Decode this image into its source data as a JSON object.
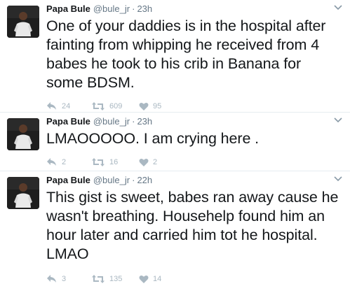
{
  "tweets": [
    {
      "fullname": "Papa Bule",
      "username": "@bule_jr",
      "separator": "·",
      "time": "23h",
      "text": "One of your daddies is in the hospital after fainting from whipping he received from 4 babes he took to his crib in Banana for some BDSM.",
      "replies": "24",
      "retweets": "609",
      "likes": "95"
    },
    {
      "fullname": "Papa Bule",
      "username": "@bule_jr",
      "separator": "·",
      "time": "23h",
      "text": "LMAOOOOO. I am crying here .",
      "replies": "2",
      "retweets": "16",
      "likes": "2"
    },
    {
      "fullname": "Papa Bule",
      "username": "@bule_jr",
      "separator": "·",
      "time": "22h",
      "text": "This gist is sweet, babes ran away cause he wasn't breathing. Househelp found him an hour later and carried him tot he hospital. LMAO",
      "replies": "3",
      "retweets": "135",
      "likes": "14"
    }
  ],
  "icons": {
    "reply": "reply-icon",
    "retweet": "retweet-icon",
    "like": "heart-icon",
    "caret": "chevron-down-icon"
  },
  "colors": {
    "text": "#14171a",
    "secondary": "#657786",
    "action": "#aab8c2",
    "divider": "#e6ecf0"
  }
}
